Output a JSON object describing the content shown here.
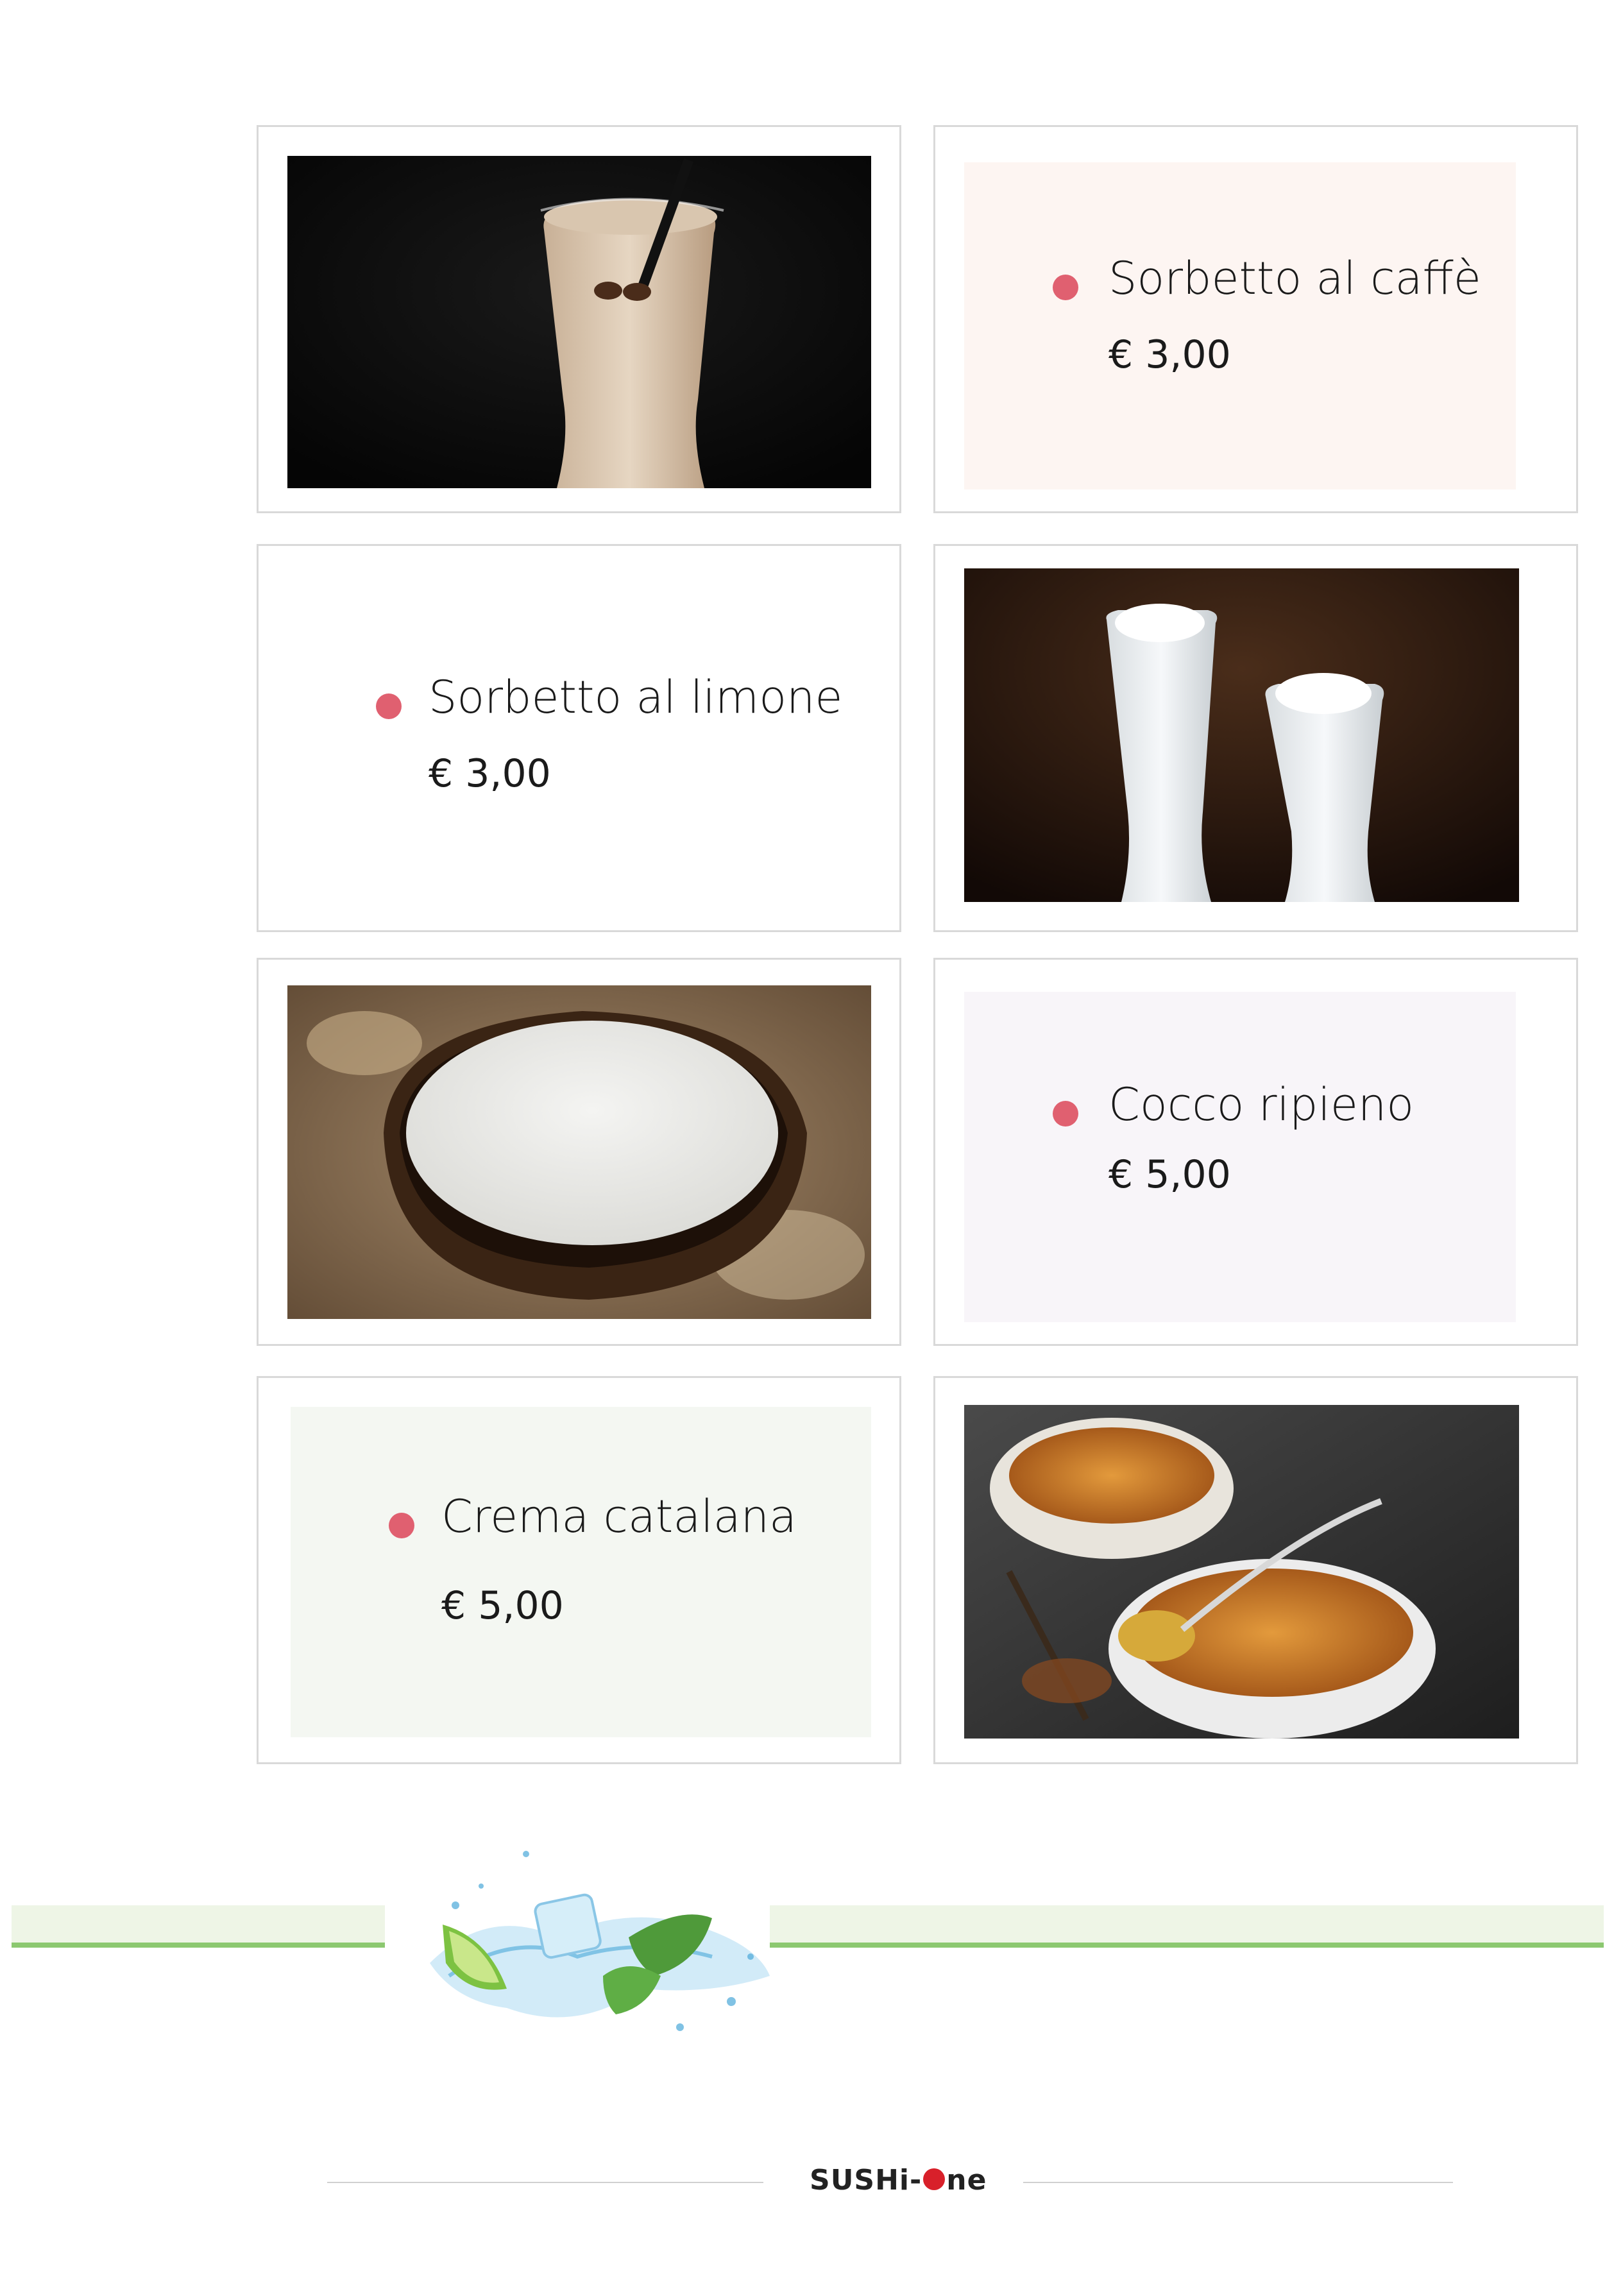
{
  "menu": {
    "items": [
      {
        "name": "Sorbetto al caffè",
        "price": "€ 3,00",
        "image": "coffee-sorbet-photo"
      },
      {
        "name": "Sorbetto al limone",
        "price": "€ 3,00",
        "image": "lemon-sorbet-photo"
      },
      {
        "name": "Cocco ripieno",
        "price": "€ 5,00",
        "image": "stuffed-coconut-photo"
      },
      {
        "name": "Crema catalana",
        "price": "€ 5,00",
        "image": "crema-catalana-photo"
      }
    ]
  },
  "footer": {
    "logo_left": "SUSHi-",
    "logo_right": "ne"
  },
  "colors": {
    "bullet": "#e06070",
    "card_border": "#d9d9d9",
    "panel_coffee": "#fdf5f2",
    "panel_coconut": "#f8f5f9",
    "panel_catalana": "#f4f7f2",
    "green_band": "#eef5e6",
    "green_line": "#8cc870"
  },
  "decor": {
    "splash_icon": "water-splash-lime-ice-mint-icon"
  }
}
